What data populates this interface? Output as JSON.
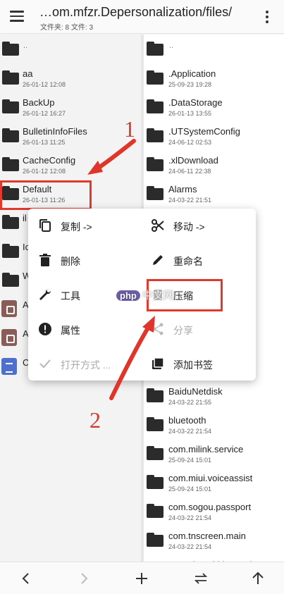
{
  "header": {
    "path": "…om.mfzr.Depersonalization/files/",
    "summary": "文件夹: 8  文件: 3",
    "menu_icon": "hamburger-menu-icon",
    "more_icon": "more-vert-icon"
  },
  "left_pane": {
    "items": [
      {
        "name": "..",
        "date": "",
        "icon": "folder-icon"
      },
      {
        "name": "aa",
        "date": "26-01-12 12:08",
        "icon": "folder-icon"
      },
      {
        "name": "BackUp",
        "date": "26-01-12 16:27",
        "icon": "folder-icon"
      },
      {
        "name": "BulletinInfoFiles",
        "date": "26-01-13 11:25",
        "icon": "folder-icon"
      },
      {
        "name": "CacheConfig",
        "date": "26-01-12 12:08",
        "icon": "folder-icon"
      },
      {
        "name": "Default",
        "date": "26-01-13 11:26",
        "icon": "folder-icon"
      },
      {
        "name": "il",
        "date": "",
        "icon": "folder-icon"
      },
      {
        "name": "Ic",
        "date": "",
        "icon": "folder-icon"
      },
      {
        "name": "W",
        "date": "",
        "icon": "folder-icon"
      },
      {
        "name": "A",
        "date": "",
        "icon": "archive-file-icon"
      },
      {
        "name": "A",
        "date": "",
        "icon": "archive-file-icon"
      },
      {
        "name": "C",
        "date": "",
        "icon": "document-file-icon"
      }
    ]
  },
  "right_pane": {
    "items": [
      {
        "name": "..",
        "date": ""
      },
      {
        "name": ".Application",
        "date": "25-09-23 19:28"
      },
      {
        "name": ".DataStorage",
        "date": "26-01-13 13:55"
      },
      {
        "name": ".UTSystemConfig",
        "date": "24-06-12 02:53"
      },
      {
        "name": ".xlDownload",
        "date": "24-06-11 22:38"
      },
      {
        "name": "Alarms",
        "date": "24-03-22 21:51"
      },
      {
        "name": "",
        "date": ""
      },
      {
        "name": "",
        "date": ""
      },
      {
        "name": "",
        "date": ""
      },
      {
        "name": "",
        "date": ""
      },
      {
        "name": "",
        "date": ""
      },
      {
        "name": "",
        "date": ""
      },
      {
        "name": "BaiduNetdisk",
        "date": "24-03-22 21:55"
      },
      {
        "name": "bluetooth",
        "date": "24-03-22 21:54"
      },
      {
        "name": "com.milink.service",
        "date": "25-09-24 15:01"
      },
      {
        "name": "com.miui.voiceassist",
        "date": "25-09-24 15:01"
      },
      {
        "name": "com.sogou.passport",
        "date": "24-03-22 21:54"
      },
      {
        "name": "com.tnscreen.main",
        "date": "24-03-22 21:54"
      },
      {
        "name": "com.xiaomi.bluetooth",
        "date": ""
      }
    ]
  },
  "context_menu": {
    "copy": "复制 ->",
    "move": "移动 ->",
    "delete": "删除",
    "rename": "重命名",
    "tools": "工具",
    "compress": "压缩",
    "properties": "属性",
    "share": "分享",
    "open_with": "打开方式 ...",
    "bookmark": "添加书签"
  },
  "annotations": {
    "step1": "1",
    "step2": "2",
    "highlight_color": "#e13a2c"
  },
  "watermark": {
    "badge": "php",
    "text": "中文网"
  },
  "bottom_bar": {
    "icons": [
      "back-chevron-icon",
      "forward-chevron-icon",
      "add-icon",
      "swap-icon",
      "up-arrow-icon"
    ]
  }
}
